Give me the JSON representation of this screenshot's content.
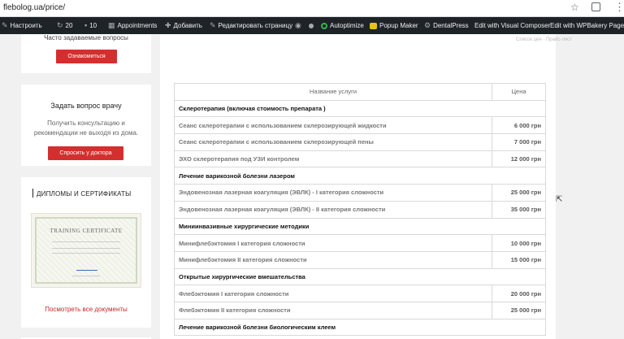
{
  "browser": {
    "url": "flebolog.ua/price/"
  },
  "adminbar": {
    "customize": "Настроить",
    "updates_count": "20",
    "comments_count": "10",
    "appointments": "Appointments",
    "add": "Добавить",
    "edit_page": "Редактировать страницу",
    "autoptimize": "Autoptimize",
    "popup_maker": "Popup Maker",
    "dentalpress": "DentalPress",
    "visual_composer": "Edit with Visual Composer",
    "wpbakery": "Edit with WPBakery Page Bu"
  },
  "sidebar": {
    "faq_text": "Часто задаваемые вопросы",
    "faq_button": "Ознакомиться",
    "ask_title": "Задать вопрос врачу",
    "ask_text": "Получить консультацию и рекомендации не выходя из дома.",
    "ask_button": "Спросить у доктора",
    "diplomas_title": "ДИПЛОМЫ И СЕРТИФИКАТЫ",
    "certificate_title": "TRAINING CERTIFICATE",
    "all_docs_link": "Посмотреть все документы"
  },
  "main": {
    "breadcrumb": "Список цен  ·  Прайс-лист"
  },
  "price_table": {
    "header_name": "Название услуги",
    "header_price": "Цена",
    "rows": [
      {
        "type": "section",
        "name": "Склеротерапия (включая стоимость препарата )"
      },
      {
        "type": "service",
        "name": "Сеанс склеротерапии с использованием склерозирующей жидкости",
        "price": "6 000 грн"
      },
      {
        "type": "service",
        "name": "Сеанс склеротерапии с использованием склерозирующей пены",
        "price": "7 000 грн"
      },
      {
        "type": "service",
        "name": "ЭХО склеротерапия под УЗИ контролем",
        "price": "12 000 грн"
      },
      {
        "type": "section",
        "name": "Лечение варикозной болезни лазером"
      },
      {
        "type": "service",
        "name": "Эндовенозная лазерная коагуляция (ЭВЛК) - I категория сложности",
        "price": "25 000 грн"
      },
      {
        "type": "service",
        "name": "Эндовенозная лазерная коагуляция (ЭВЛК) - II категория сложности",
        "price": "35 000 грн"
      },
      {
        "type": "section",
        "name": "Миниинвазивные хирургические методики"
      },
      {
        "type": "service",
        "name": "Минифлебэктомия I категория сложности",
        "price": "10 000 грн"
      },
      {
        "type": "service",
        "name": "Минифлебэктомия II категория сложности",
        "price": "15 000 грн"
      },
      {
        "type": "section",
        "name": "Открытые хирургические вмешательства"
      },
      {
        "type": "service",
        "name": "Флебэктомия I категория сложности",
        "price": "20 000 грн"
      },
      {
        "type": "service",
        "name": "Флебэктомия II категория сложности",
        "price": "25 000 грн"
      },
      {
        "type": "section",
        "name": "Лечение варикозной болезни биологическим клеем"
      }
    ]
  }
}
